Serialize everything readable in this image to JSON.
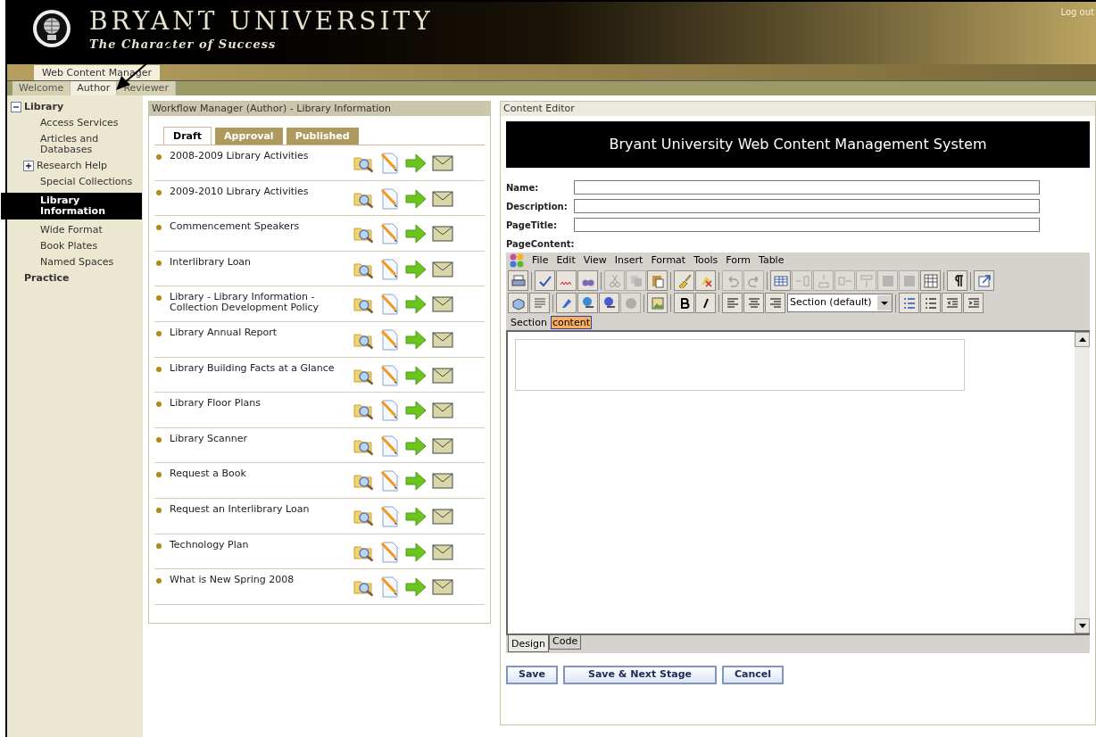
{
  "header": {
    "title": "BRYANT UNIVERSITY",
    "tagline": "The Character of Success",
    "logout": "Log out"
  },
  "app_tab": "Web Content Manager",
  "nav_tabs": [
    {
      "label": "Welcome",
      "selected": false
    },
    {
      "label": "Author",
      "selected": true
    },
    {
      "label": "Reviewer",
      "selected": false
    }
  ],
  "sidebar": {
    "items": [
      {
        "label": "Library",
        "selected": false,
        "expanded": true,
        "children": [
          {
            "label": "Access Services",
            "selected": false
          },
          {
            "label": "Articles and Databases",
            "selected": false
          },
          {
            "label": "Research Help",
            "selected": false,
            "expanded": false
          },
          {
            "label": "Special Collections",
            "selected": false
          },
          {
            "label": "Library Information",
            "selected": true
          },
          {
            "label": "Wide Format",
            "selected": false
          },
          {
            "label": "Book Plates",
            "selected": false
          },
          {
            "label": "Named Spaces",
            "selected": false
          }
        ]
      },
      {
        "label": "Practice",
        "selected": false
      }
    ]
  },
  "workflow": {
    "title": "Workflow Manager (Author) - Library Information",
    "tabs": [
      {
        "label": "Draft",
        "selected": true
      },
      {
        "label": "Approval",
        "selected": false
      },
      {
        "label": "Published",
        "selected": false
      }
    ],
    "items": [
      {
        "title": "2008-2009 Library Activities"
      },
      {
        "title": "2009-2010 Library Activities"
      },
      {
        "title": "Commencement Speakers"
      },
      {
        "title": "Interlibrary Loan"
      },
      {
        "title": "Library - Library Information - Collection Development Policy"
      },
      {
        "title": "Library Annual Report"
      },
      {
        "title": "Library Building Facts at a Glance"
      },
      {
        "title": "Library Floor Plans"
      },
      {
        "title": "Library Scanner"
      },
      {
        "title": "Request a Book"
      },
      {
        "title": "Request an Interlibrary Loan"
      },
      {
        "title": "Technology Plan"
      },
      {
        "title": "What is New Spring 2008"
      }
    ]
  },
  "editor": {
    "panel_title": "Content Editor",
    "banner": "Bryant University Web Content Management System",
    "fields": [
      {
        "label": "Name:"
      },
      {
        "label": "Description:"
      },
      {
        "label": "PageTitle:"
      }
    ],
    "page_content_label": "PageContent:",
    "menu": [
      "File",
      "Edit",
      "View",
      "Insert",
      "Format",
      "Tools",
      "Form",
      "Table"
    ],
    "style_select": "Section (default)",
    "breadcrumb": [
      {
        "label": "Section",
        "selected": false
      },
      {
        "label": "content",
        "selected": true
      }
    ],
    "view_tabs": [
      {
        "label": "Design",
        "selected": true
      },
      {
        "label": "Code",
        "selected": false
      }
    ],
    "buttons": [
      "Save",
      "Save & Next Stage",
      "Cancel"
    ]
  }
}
